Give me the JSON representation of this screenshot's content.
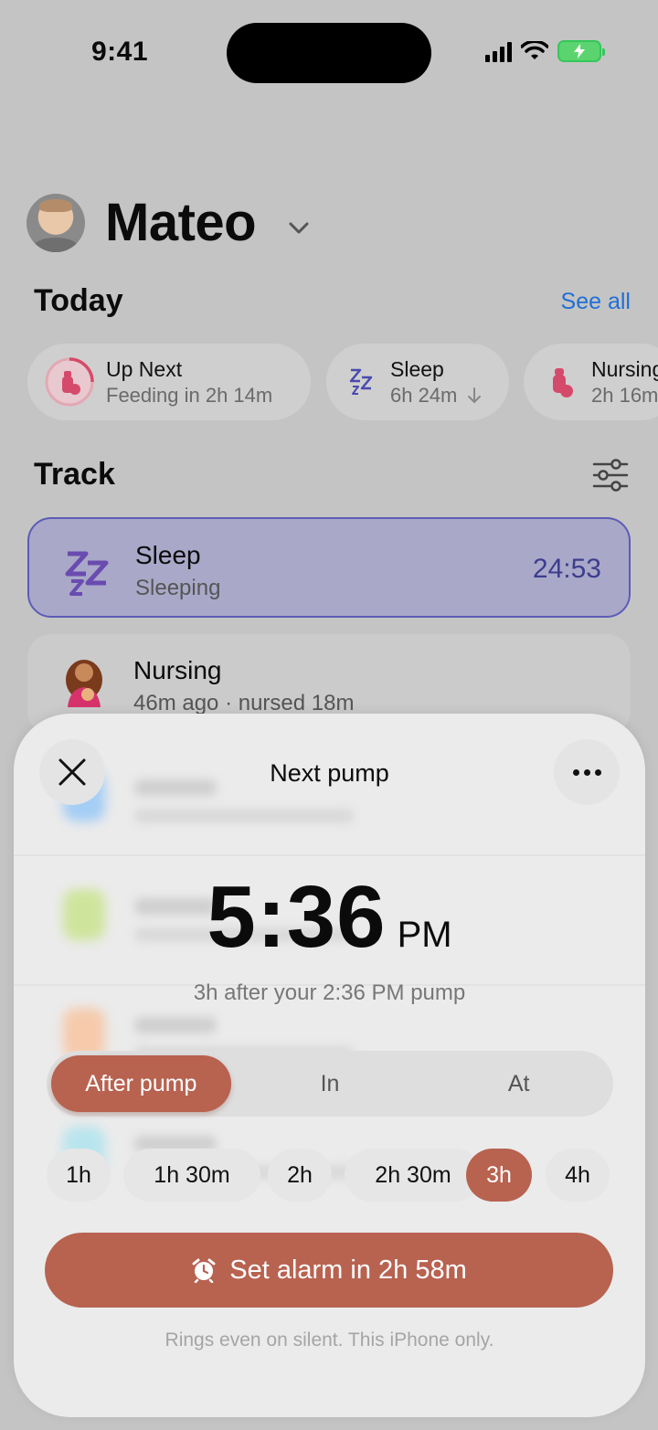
{
  "status": {
    "time": "9:41"
  },
  "header": {
    "name": "Mateo"
  },
  "today": {
    "title": "Today",
    "see_all": "See all",
    "chips": [
      {
        "title": "Up Next",
        "sub": "Feeding in 2h 14m",
        "icon": "bottle-progress-icon"
      },
      {
        "title": "Sleep",
        "sub": "6h 24m",
        "icon": "zz-icon"
      },
      {
        "title": "Nursing",
        "sub": "2h 16m",
        "icon": "bottle-icon"
      }
    ]
  },
  "track": {
    "title": "Track",
    "sleep": {
      "title": "Sleep",
      "sub": "Sleeping",
      "timer": "24:53"
    },
    "nursing": {
      "title": "Nursing",
      "sub": "46m ago · nursed 18m"
    }
  },
  "sheet": {
    "title": "Next pump",
    "time": "5:36",
    "ampm": "PM",
    "subline": "3h after your 2:36 PM pump",
    "segments": [
      "After pump",
      "In",
      "At"
    ],
    "segment_selected": "After pump",
    "durations": [
      "1h",
      "1h 30m",
      "2h",
      "2h 30m",
      "3h",
      "4h"
    ],
    "duration_selected": "3h",
    "alarm_label": "Set alarm in 2h 58m",
    "footnote": "Rings even on silent. This iPhone only."
  },
  "colors": {
    "accent": "#b86250",
    "link": "#1f6fd6",
    "sleep_card": "#a9a8c8",
    "sleep_border": "#5c5cb8"
  }
}
